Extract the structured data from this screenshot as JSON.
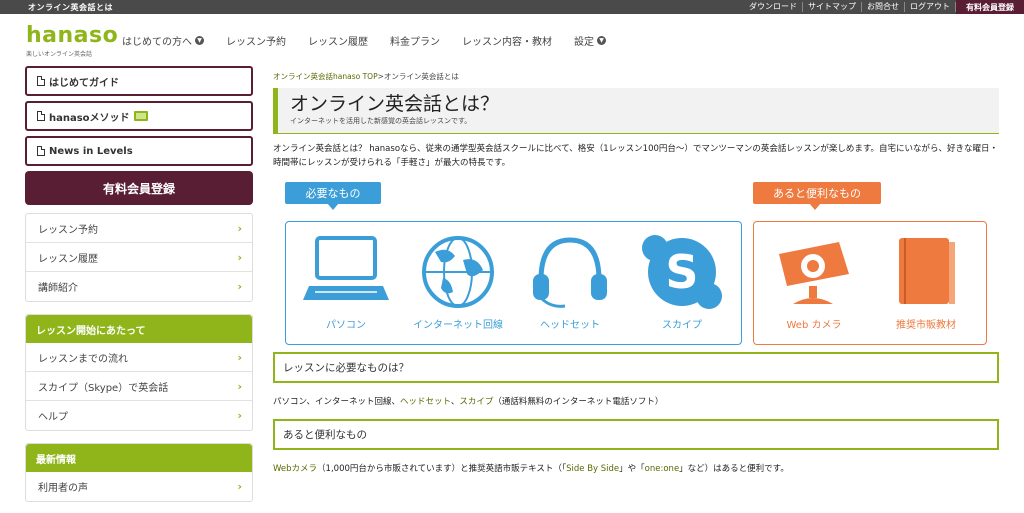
{
  "topbar": {
    "tagline": "オンライン英会話とは",
    "links": [
      "ダウンロード",
      "サイトマップ",
      "お問合せ",
      "ログアウト"
    ],
    "register": "有料会員登録"
  },
  "logo": {
    "name": "hanaso",
    "sub": "楽しいオンライン英会話"
  },
  "nav": [
    {
      "label": "はじめての方へ",
      "chev": true
    },
    {
      "label": "レッスン予約",
      "chev": false
    },
    {
      "label": "レッスン履歴",
      "chev": false
    },
    {
      "label": "料金プラン",
      "chev": false
    },
    {
      "label": "レッスン内容・教材",
      "chev": false
    },
    {
      "label": "設定",
      "chev": true
    }
  ],
  "sidebar": {
    "guides": [
      "はじめてガイド",
      "hanasoメソッド",
      "News in Levels"
    ],
    "register": "有料会員登録",
    "menu1": [
      "レッスン予約",
      "レッスン履歴",
      "講師紹介"
    ],
    "menu2_head": "レッスン開始にあたって",
    "menu2": [
      "レッスンまでの流れ",
      "スカイプ（Skype）で英会話",
      "ヘルプ"
    ],
    "menu3_head": "最新情報",
    "menu3": [
      "利用者の声"
    ]
  },
  "main": {
    "breadcrumb_link": "オンライン英会話hanaso TOP",
    "breadcrumb_sep": ">",
    "breadcrumb_current": "オンライン英会話とは",
    "title": "オンライン英会話とは？",
    "subtitle": "インターネットを活用した新感覚の英会話レッスンです。",
    "intro": "オンライン英会話とは？ hanasoなら、従来の通学型英会話スクールに比べて、格安（1レッスン100円台〜）でマンツーマンの英会話レッスンが楽しめます。自宅にいながら、好きな曜日・時間帯にレッスンが受けられる「手軽さ」が最大の特長です。",
    "needs_tag": "必要なもの",
    "useful_tag": "あると便利なもの",
    "needs_items": [
      "パソコン",
      "インターネット回線",
      "ヘッドセット",
      "スカイプ"
    ],
    "useful_items": [
      "Web カメラ",
      "推奨市販教材"
    ],
    "section1_title": "レッスンに必要なものは？",
    "section1_text": [
      "パソコン、インターネット回線、",
      "ヘッドセット",
      "、",
      "スカイプ",
      "（通話料無料のインターネット電話ソフト）"
    ],
    "section2_title": "あると便利なもの",
    "section2_text": [
      "Webカメラ",
      "（1,000円台から市販されています）と推奨英語市販テキスト（「",
      "Side By Side",
      "」や「",
      "one:one",
      "」など）はあると便利です。"
    ]
  },
  "colors": {
    "green": "#8fb51a",
    "maroon": "#5a1e34",
    "blue": "#3c9ed8",
    "orange": "#ee7a3f"
  }
}
